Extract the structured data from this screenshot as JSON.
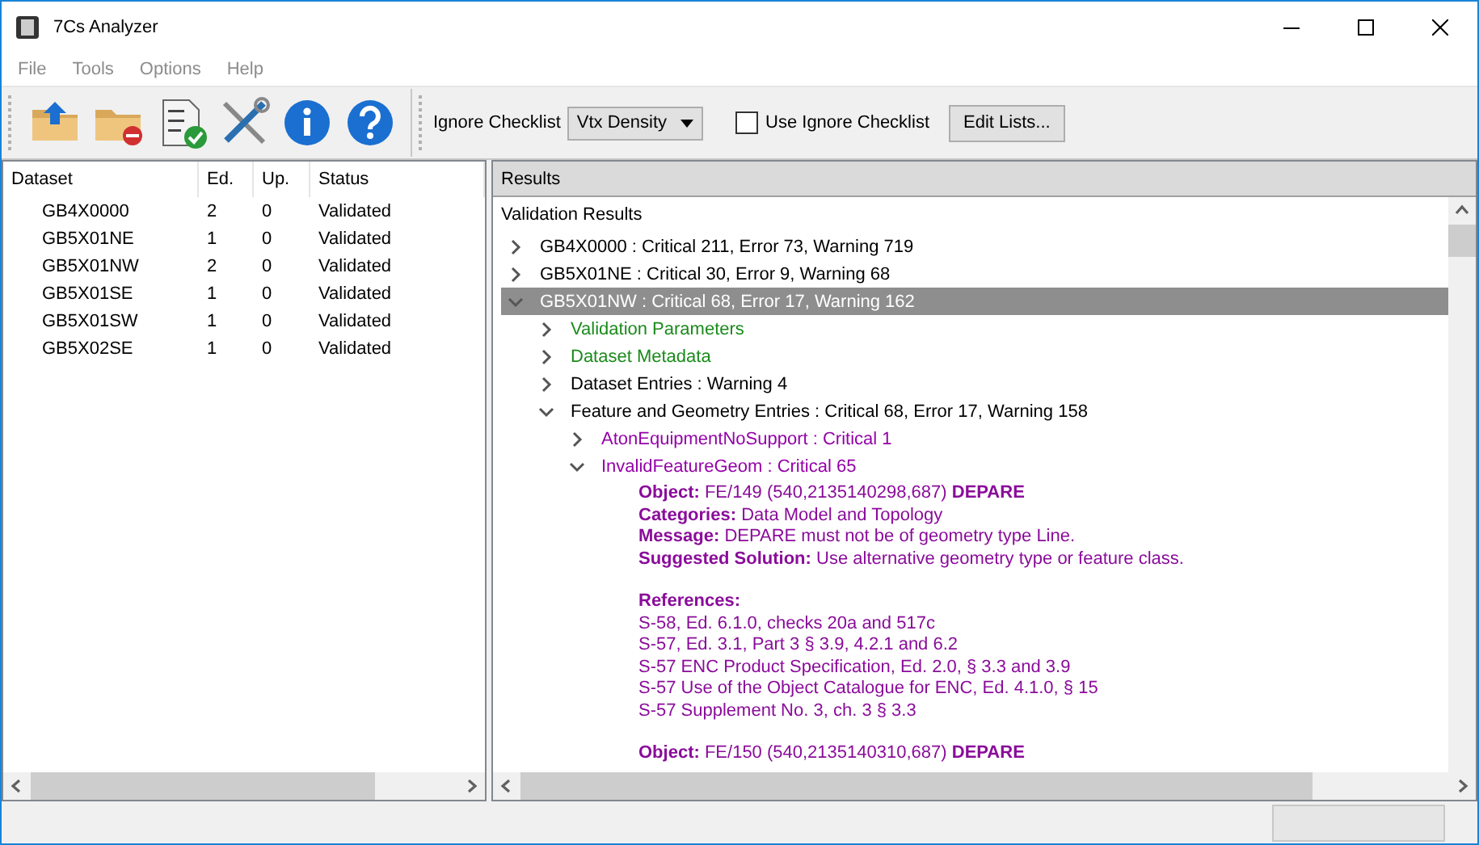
{
  "window": {
    "title": "7Cs Analyzer"
  },
  "menu": [
    {
      "label": "File"
    },
    {
      "label": "Tools"
    },
    {
      "label": "Options"
    },
    {
      "label": "Help"
    }
  ],
  "toolbar": {
    "ignore_label": "Ignore Checklist",
    "ignore_value": "Vtx Density",
    "use_ignore": {
      "label": "Use Ignore Checklist",
      "checked": false
    },
    "edit_button": "Edit Lists..."
  },
  "datasets": {
    "columns": [
      "Dataset",
      "Ed.",
      "Up.",
      "Status"
    ],
    "rows": [
      [
        "GB4X0000",
        "2",
        "0",
        "Validated"
      ],
      [
        "GB5X01NE",
        "1",
        "0",
        "Validated"
      ],
      [
        "GB5X01NW",
        "2",
        "0",
        "Validated"
      ],
      [
        "GB5X01SE",
        "1",
        "0",
        "Validated"
      ],
      [
        "GB5X01SW",
        "1",
        "0",
        "Validated"
      ],
      [
        "GB5X02SE",
        "1",
        "0",
        "Validated"
      ]
    ]
  },
  "results": {
    "header": "Results",
    "heading": "Validation Results",
    "tree": [
      {
        "kind": "dataset",
        "label": "GB4X0000 : Critical 211, Error 73, Warning 719",
        "expanded": false,
        "selected": false
      },
      {
        "kind": "dataset",
        "label": "GB5X01NE : Critical 30, Error 9, Warning 68",
        "expanded": false,
        "selected": false
      },
      {
        "kind": "dataset",
        "label": "GB5X01NW : Critical 68, Error 17, Warning 162",
        "expanded": true,
        "selected": true,
        "children": [
          {
            "kind": "info",
            "label": "Validation Parameters",
            "expanded": false,
            "selected": false
          },
          {
            "kind": "info",
            "label": "Dataset Metadata",
            "expanded": false,
            "selected": false
          },
          {
            "kind": "section",
            "label": "Dataset Entries : Warning 4",
            "expanded": false,
            "selected": false
          },
          {
            "kind": "section",
            "label": "Feature and Geometry Entries : Critical 68, Error 17, Warning 158",
            "expanded": true,
            "selected": false,
            "children": [
              {
                "kind": "check",
                "label": "AtonEquipmentNoSupport : Critical 1",
                "expanded": false,
                "selected": false
              },
              {
                "kind": "check",
                "label": "InvalidFeatureGeom : Critical 65",
                "expanded": true,
                "selected": false,
                "findings": [
                  {
                    "lines": [
                      "**Object:** FE/149 (540,2135140298,687) **DEPARE**",
                      "**Categories:** Data Model and Topology",
                      "**Message:** DEPARE must not be of geometry type Line.",
                      "**Suggested Solution:** Use alternative geometry type or feature class."
                    ],
                    "references_heading": "References:",
                    "references": [
                      "S-58, Ed. 6.1.0, checks 20a and 517c",
                      "S-57, Ed. 3.1, Part 3 § 3.9, 4.2.1 and 6.2",
                      "S-57 ENC Product Specification, Ed. 2.0, § 3.3 and 3.9",
                      "S-57 Use of the Object Catalogue for ENC, Ed. 4.1.0, § 15",
                      "S-57 Supplement No. 3, ch. 3 § 3.3"
                    ]
                  },
                  {
                    "lines": [
                      "**Object:** FE/150 (540,2135140310,687) **DEPARE**"
                    ]
                  }
                ]
              }
            ]
          }
        ]
      }
    ]
  }
}
